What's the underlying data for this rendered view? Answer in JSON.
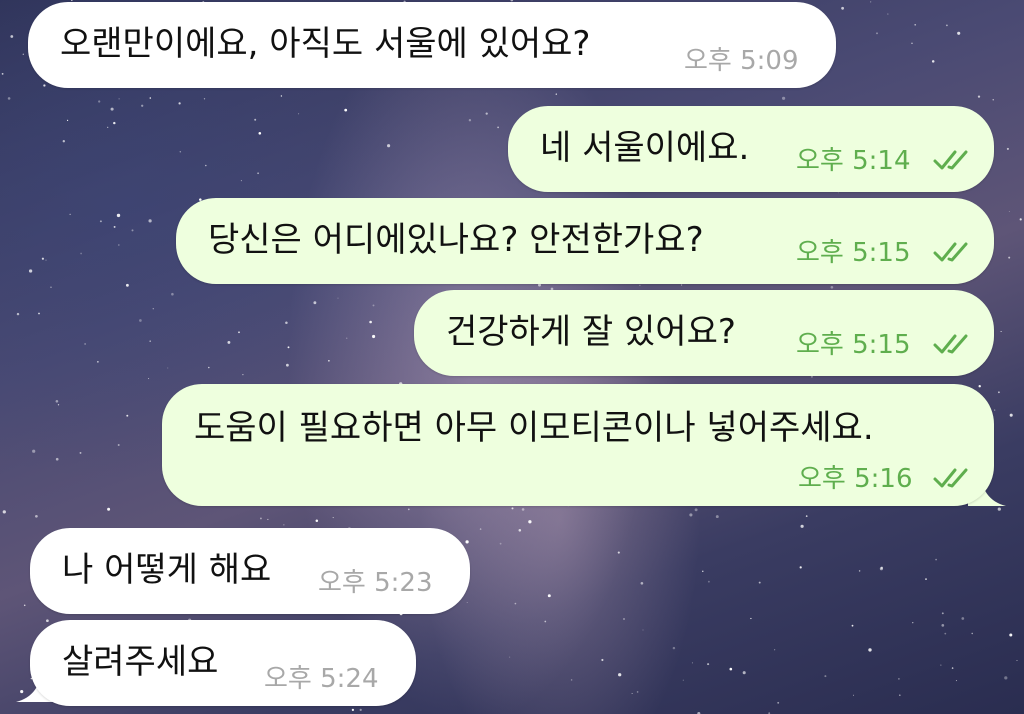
{
  "colors": {
    "incoming_bubble": "#ffffff",
    "outgoing_bubble": "#eeffde",
    "incoming_time": "#a8a8a8",
    "outgoing_time": "#5fae4e",
    "read_check": "#5fae4e"
  },
  "messages": [
    {
      "direction": "incoming",
      "text": "오랜만이에요, 아직도 서울에 있어요?",
      "time": "오후 5:09"
    },
    {
      "direction": "outgoing",
      "text": "네 서울이에요.",
      "time": "오후 5:14",
      "status_icon": "double-check-icon"
    },
    {
      "direction": "outgoing",
      "text": "당신은 어디에있나요? 안전한가요?",
      "time": "오후 5:15",
      "status_icon": "double-check-icon"
    },
    {
      "direction": "outgoing",
      "text": "건강하게 잘 있어요?",
      "time": "오후 5:15",
      "status_icon": "double-check-icon"
    },
    {
      "direction": "outgoing",
      "text": "도움이 필요하면 아무 이모티콘이나 넣어주세요.",
      "time": "오후 5:16",
      "status_icon": "double-check-icon"
    },
    {
      "direction": "incoming",
      "text": "나 어떻게 해요",
      "time": "오후 5:23"
    },
    {
      "direction": "incoming",
      "text": "살려주세요",
      "time": "오후 5:24"
    }
  ]
}
